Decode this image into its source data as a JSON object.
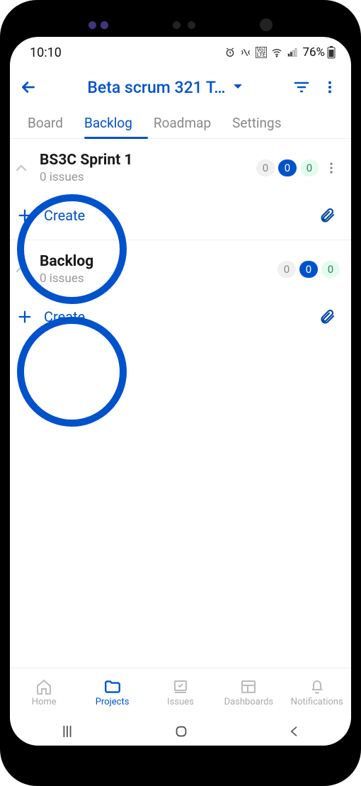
{
  "statusbar": {
    "time": "10:10",
    "battery": "76%"
  },
  "header": {
    "title": "Beta scrum 321 T…"
  },
  "tabs": [
    "Board",
    "Backlog",
    "Roadmap",
    "Settings"
  ],
  "activeTab": 1,
  "sections": [
    {
      "title": "BS3C Sprint 1",
      "subtitle": "0 issues",
      "counts": {
        "todo": "0",
        "inprogress": "0",
        "done": "0"
      },
      "showMore": true,
      "createLabel": "Create"
    },
    {
      "title": "Backlog",
      "subtitle": "0 issues",
      "counts": {
        "todo": "0",
        "inprogress": "0",
        "done": "0"
      },
      "showMore": false,
      "createLabel": "Create"
    }
  ],
  "bottomnav": {
    "items": [
      "Home",
      "Projects",
      "Issues",
      "Dashboards",
      "Notifications"
    ],
    "active": 1
  }
}
